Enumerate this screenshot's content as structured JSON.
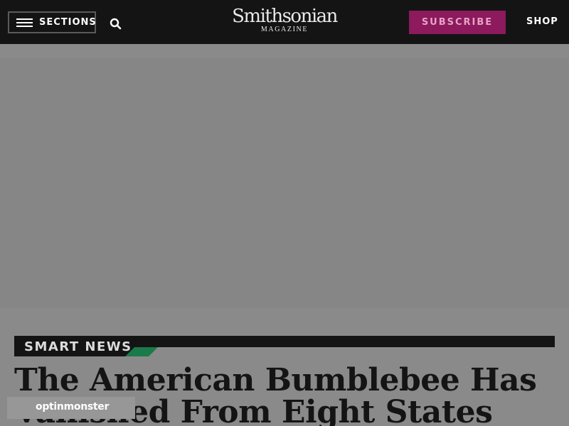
{
  "header": {
    "sections_label": "SECTIONS",
    "menu_icon": "hamburger-menu-icon",
    "search_icon": "search-icon",
    "logo_main": "Smithsonian",
    "logo_sub": "MAGAZINE",
    "subscribe_label": "SUBSCRIBE",
    "shop_label": "SHOP"
  },
  "article": {
    "section_label": "SMART NEWS",
    "headline": "The American Bumblebee Has Vanished From Eight States"
  },
  "badge": {
    "label": "optinmonster"
  },
  "colors": {
    "header_bg": "#141414",
    "subscribe_bg": "#8c1a5c",
    "subscribe_text": "#e6a3c8",
    "section_accent": "#1a7a4a",
    "overlay_gray": "#8a8a8a"
  }
}
